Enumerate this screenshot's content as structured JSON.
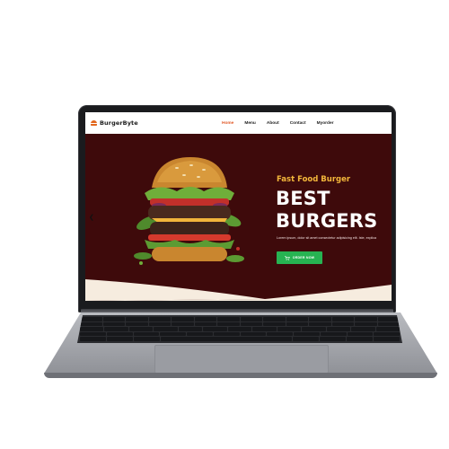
{
  "site": {
    "brand": "BurgerByte",
    "nav": [
      "Home",
      "Menu",
      "About",
      "Contact",
      "Myorder"
    ],
    "active_nav": "Home"
  },
  "hero": {
    "tagline": "Fast Food Burger",
    "title_line1": "BEST",
    "title_line2": "BURGERS",
    "description": "Lorem ipsum, dolor sit amet consectetur adipisicing elit. Iste, explica",
    "cta_label": "ORDER NOW"
  },
  "colors": {
    "hero_bg": "#3e0a0b",
    "accent_nav": "#e25b2a",
    "tagline": "#f3b73b",
    "cta": "#27b352"
  },
  "icons": [
    "burger-logo-icon",
    "chevron-left-icon",
    "cart-icon"
  ]
}
